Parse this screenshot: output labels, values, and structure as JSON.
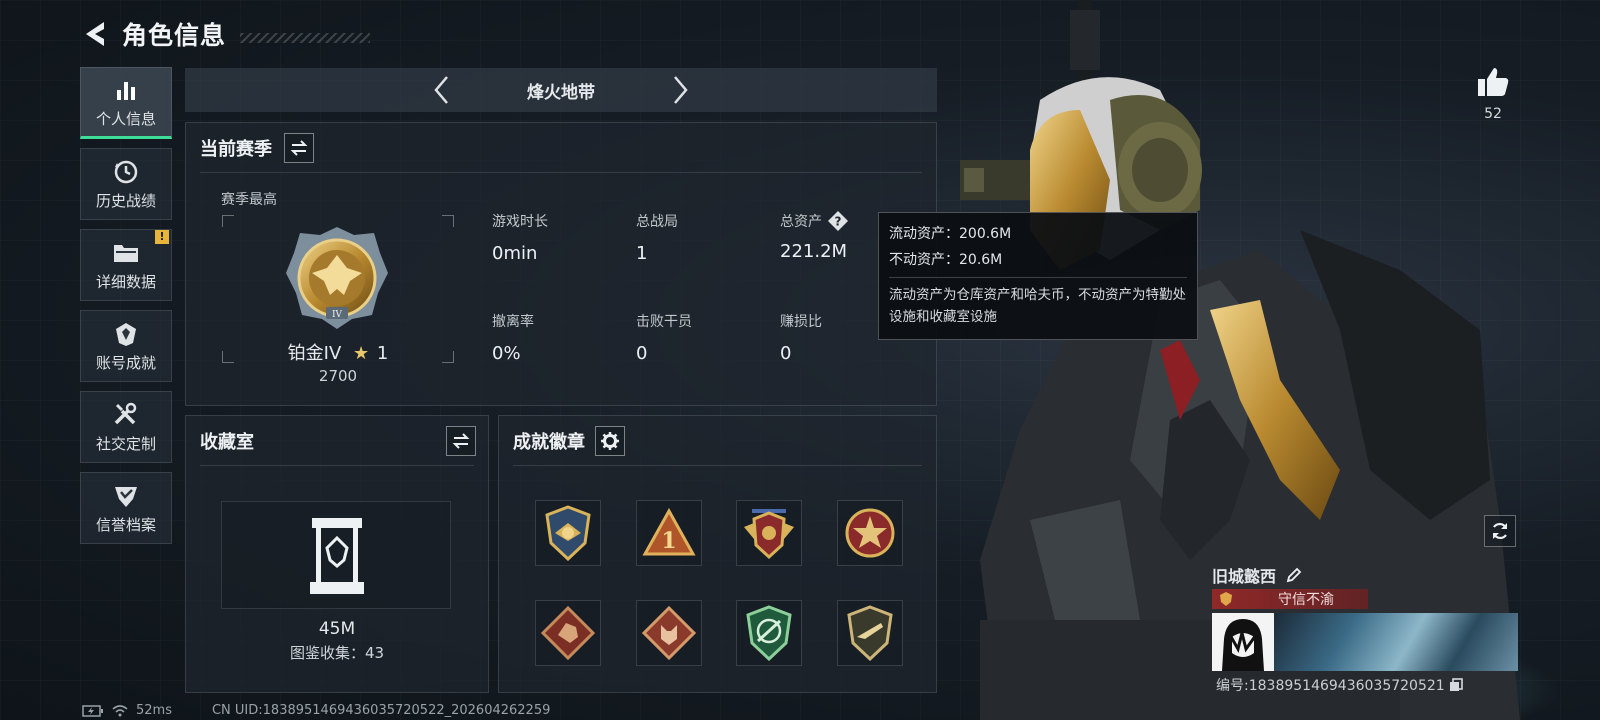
{
  "header": {
    "title": "角色信息"
  },
  "sidebar": {
    "items": [
      {
        "label": "个人信息",
        "icon": "bar-chart-icon",
        "active": true
      },
      {
        "label": "历史战绩",
        "icon": "clock-icon"
      },
      {
        "label": "详细数据",
        "icon": "folder-icon",
        "alert": "!"
      },
      {
        "label": "账号成就",
        "icon": "crest-icon"
      },
      {
        "label": "社交定制",
        "icon": "wrench-screwdriver-icon"
      },
      {
        "label": "信誉档案",
        "icon": "shield-check-icon"
      }
    ]
  },
  "mode": {
    "title": "烽火地带"
  },
  "season": {
    "title": "当前赛季",
    "subtitle": "赛季最高",
    "rank_name": "铂金IV",
    "rank_star_count": "1",
    "rank_score": "2700",
    "stats": [
      {
        "label": "游戏时长",
        "value": "0min"
      },
      {
        "label": "总战局",
        "value": "1"
      },
      {
        "label": "总资产",
        "value": "221.2M",
        "has_help": true
      },
      {
        "label": "撤离率",
        "value": "0%"
      },
      {
        "label": "击败干员",
        "value": "0"
      },
      {
        "label": "赚损比",
        "value": "0"
      }
    ]
  },
  "tooltip": {
    "line1": "流动资产：200.6M",
    "line2": "不动资产：20.6M",
    "desc": "流动资产为仓库资产和哈夫币，不动资产为特勤处设施和收藏室设施"
  },
  "collection": {
    "title": "收藏室",
    "value": "45M",
    "count": "图鉴收集：43"
  },
  "badges": {
    "title": "成就徽章",
    "items": [
      "eagle-shield-badge",
      "triangle-one-badge",
      "winged-shield-badge",
      "star-round-badge",
      "dragon-diamond-badge",
      "wolf-diamond-badge",
      "green-shield-badge",
      "rifle-shield-badge"
    ]
  },
  "social": {
    "likes": "52",
    "player_name": "旧城懿西",
    "reputation": "守信不渝",
    "player_id": "编号:1838951469436035720521"
  },
  "status": {
    "ping": "52ms",
    "uid": "CN UID:1838951469436035720522_202604262259"
  },
  "colors": {
    "accent": "#3ddc97",
    "alert": "#e6b53a",
    "reputation": "#962828"
  }
}
